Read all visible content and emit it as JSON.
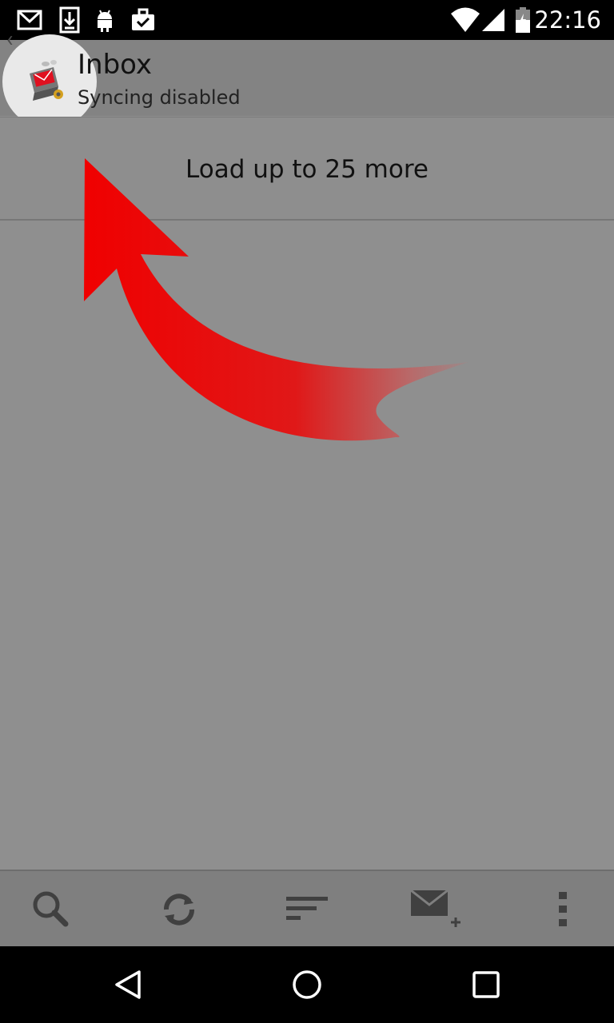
{
  "status_bar": {
    "time": "22:16",
    "icons": [
      "gmail-icon",
      "download-icon",
      "android-icon",
      "briefcase-check-icon",
      "wifi-icon",
      "signal-icon",
      "battery-icon"
    ]
  },
  "action_bar": {
    "title": "Inbox",
    "subtitle": "Syncing disabled",
    "back_glyph": "‹"
  },
  "message_list": {
    "load_more_label": "Load up to 25 more"
  },
  "toolbar": {
    "items": [
      "search-icon",
      "refresh-icon",
      "sort-icon",
      "compose-icon",
      "overflow-menu-icon"
    ]
  },
  "nav_bar": {
    "items": [
      "back-icon",
      "home-icon",
      "recents-icon"
    ]
  },
  "colors": {
    "arrow": "#e00000",
    "status_bar": "#000000",
    "toolbar": "#7f7f7f",
    "overlay_dim": "#8f8f8f"
  }
}
